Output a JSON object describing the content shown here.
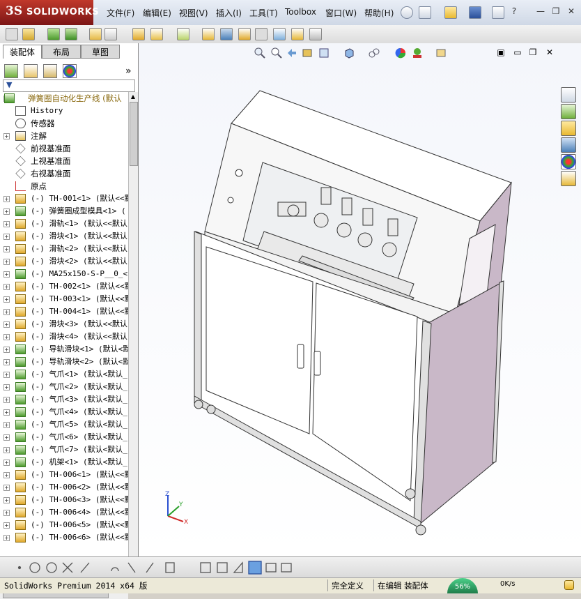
{
  "app": {
    "brand": "SOLIDWORKS",
    "brand_prefix": "3S"
  },
  "menu": [
    {
      "label": "文件(F)"
    },
    {
      "label": "编辑(E)"
    },
    {
      "label": "视图(V)"
    },
    {
      "label": "插入(I)"
    },
    {
      "label": "工具(T)"
    },
    {
      "label": "Toolbox"
    },
    {
      "label": "窗口(W)"
    },
    {
      "label": "帮助(H)"
    }
  ],
  "panel": {
    "tabs": [
      "装配体",
      "布局",
      "草图"
    ],
    "expand_arrows": "»",
    "filter_glyph": "▼"
  },
  "tree": [
    {
      "label": "弹簧圈自动化生产线  (默认",
      "level": 0,
      "icon": "assembly-warning-icon",
      "expand": "-"
    },
    {
      "label": "History",
      "level": 1,
      "icon": "history-icon",
      "expand": ""
    },
    {
      "label": "传感器",
      "level": 1,
      "icon": "sensor-icon",
      "expand": ""
    },
    {
      "label": "注解",
      "level": 1,
      "icon": "annotation-icon",
      "expand": "+"
    },
    {
      "label": "前视基准面",
      "level": 1,
      "icon": "plane-icon",
      "expand": ""
    },
    {
      "label": "上视基准面",
      "level": 1,
      "icon": "plane-icon",
      "expand": ""
    },
    {
      "label": "右视基准面",
      "level": 1,
      "icon": "plane-icon",
      "expand": ""
    },
    {
      "label": "原点",
      "level": 1,
      "icon": "origin-icon",
      "expand": ""
    },
    {
      "label": "(-) TH-001<1> (默认<<默",
      "level": 1,
      "icon": "part-icon",
      "expand": "+"
    },
    {
      "label": "(-) 弹簧圈成型模具<1> (",
      "level": 1,
      "icon": "subassembly-icon",
      "expand": "+"
    },
    {
      "label": "(-) 滑轨<1> (默认<<默认",
      "level": 1,
      "icon": "part-icon",
      "expand": "+"
    },
    {
      "label": "(-) 滑块<1> (默认<<默认",
      "level": 1,
      "icon": "part-icon",
      "expand": "+"
    },
    {
      "label": "(-) 滑轨<2> (默认<<默认",
      "level": 1,
      "icon": "part-icon",
      "expand": "+"
    },
    {
      "label": "(-) 滑块<2> (默认<<默认",
      "level": 1,
      "icon": "part-icon",
      "expand": "+"
    },
    {
      "label": "(-) MA25x150-S-P__0_<1>",
      "level": 1,
      "icon": "subassembly-icon",
      "expand": "+"
    },
    {
      "label": "(-) TH-002<1> (默认<<默",
      "level": 1,
      "icon": "part-icon",
      "expand": "+"
    },
    {
      "label": "(-) TH-003<1> (默认<<默",
      "level": 1,
      "icon": "part-icon",
      "expand": "+"
    },
    {
      "label": "(-) TH-004<1> (默认<<默",
      "level": 1,
      "icon": "part-icon",
      "expand": "+"
    },
    {
      "label": "(-) 滑块<3> (默认<<默认",
      "level": 1,
      "icon": "part-icon",
      "expand": "+"
    },
    {
      "label": "(-) 滑块<4> (默认<<默认",
      "level": 1,
      "icon": "part-icon",
      "expand": "+"
    },
    {
      "label": "(-) 导轨滑块<1> (默认<默",
      "level": 1,
      "icon": "subassembly-icon",
      "expand": "+"
    },
    {
      "label": "(-) 导轨滑块<2> (默认<默",
      "level": 1,
      "icon": "subassembly-icon",
      "expand": "+"
    },
    {
      "label": "(-) 气爪<1> (默认<默认_",
      "level": 1,
      "icon": "subassembly-icon",
      "expand": "+"
    },
    {
      "label": "(-) 气爪<2> (默认<默认_",
      "level": 1,
      "icon": "subassembly-icon",
      "expand": "+"
    },
    {
      "label": "(-) 气爪<3> (默认<默认_",
      "level": 1,
      "icon": "subassembly-icon",
      "expand": "+"
    },
    {
      "label": "(-) 气爪<4> (默认<默认_",
      "level": 1,
      "icon": "subassembly-icon",
      "expand": "+"
    },
    {
      "label": "(-) 气爪<5> (默认<默认_",
      "level": 1,
      "icon": "subassembly-icon",
      "expand": "+"
    },
    {
      "label": "(-) 气爪<6> (默认<默认_",
      "level": 1,
      "icon": "subassembly-icon",
      "expand": "+"
    },
    {
      "label": "(-) 气爪<7> (默认<默认_",
      "level": 1,
      "icon": "subassembly-icon",
      "expand": "+"
    },
    {
      "label": "(-) 机架<1> (默认<默认_",
      "level": 1,
      "icon": "subassembly-icon",
      "expand": "+"
    },
    {
      "label": "(-) TH-006<1> (默认<<默",
      "level": 1,
      "icon": "part-icon",
      "expand": "+"
    },
    {
      "label": "(-) TH-006<2> (默认<<默",
      "level": 1,
      "icon": "part-icon",
      "expand": "+"
    },
    {
      "label": "(-) TH-006<3> (默认<<默",
      "level": 1,
      "icon": "part-icon",
      "expand": "+"
    },
    {
      "label": "(-) TH-006<4> (默认<<默",
      "level": 1,
      "icon": "part-icon",
      "expand": "+"
    },
    {
      "label": "(-) TH-006<5> (默认<<默",
      "level": 1,
      "icon": "part-icon",
      "expand": "+"
    },
    {
      "label": "(-) TH-006<6> (默认<<默",
      "level": 1,
      "icon": "part-icon",
      "expand": "+"
    }
  ],
  "triad": {
    "x": "X",
    "y": "Y",
    "z": "Z"
  },
  "status": {
    "product": "SolidWorks Premium 2014 x64 版",
    "definition": "完全定义",
    "mode": "在编辑 装配体",
    "cpu_percent": "56%",
    "net_speed": "0K/s"
  },
  "colors": {
    "accent": "#c0392b",
    "panel_bg": "#d4d0c8",
    "model_side": "#c9b8c8"
  }
}
